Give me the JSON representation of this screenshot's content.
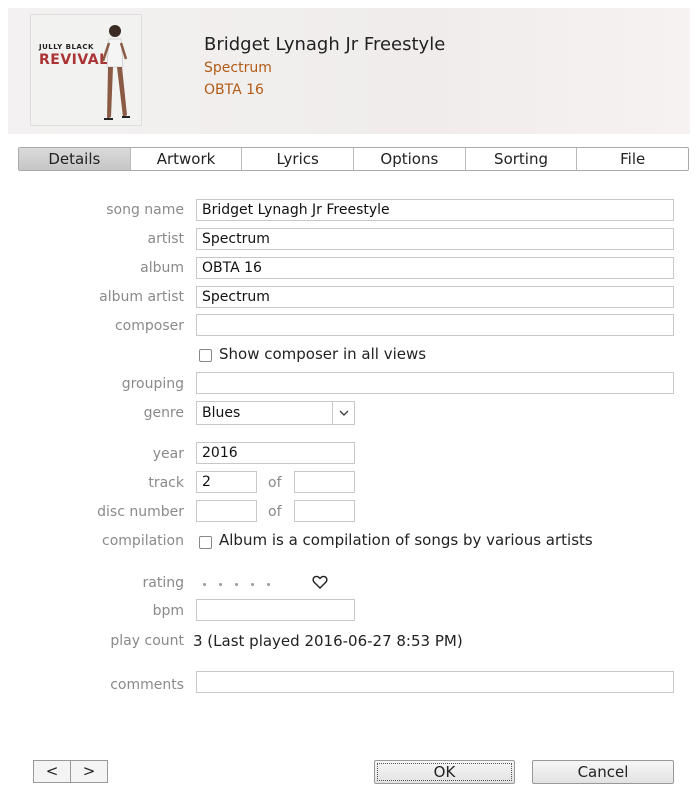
{
  "header": {
    "album_art_text_line1": "JULLY BLACK",
    "album_art_text_line2": "REVIVAL",
    "title": "Bridget Lynagh Jr Freestyle",
    "artist": "Spectrum",
    "album": "OBTA 16"
  },
  "tabs": [
    {
      "label": "Details",
      "active": true
    },
    {
      "label": "Artwork",
      "active": false
    },
    {
      "label": "Lyrics",
      "active": false
    },
    {
      "label": "Options",
      "active": false
    },
    {
      "label": "Sorting",
      "active": false
    },
    {
      "label": "File",
      "active": false
    }
  ],
  "form": {
    "song_name": {
      "label": "song name",
      "value": "Bridget Lynagh Jr Freestyle"
    },
    "artist": {
      "label": "artist",
      "value": "Spectrum"
    },
    "album": {
      "label": "album",
      "value": "OBTA 16"
    },
    "album_artist": {
      "label": "album artist",
      "value": "Spectrum"
    },
    "composer": {
      "label": "composer",
      "value": ""
    },
    "show_composer": {
      "label": "Show composer in all views",
      "checked": false
    },
    "grouping": {
      "label": "grouping",
      "value": ""
    },
    "genre": {
      "label": "genre",
      "value": "Blues"
    },
    "year": {
      "label": "year",
      "value": "2016"
    },
    "track": {
      "label": "track",
      "value": "2",
      "of_label": "of",
      "of_value": ""
    },
    "disc_number": {
      "label": "disc number",
      "value": "",
      "of_label": "of",
      "of_value": ""
    },
    "compilation": {
      "label": "compilation",
      "checkbox_label": "Album is a compilation of songs by various artists",
      "checked": false
    },
    "rating": {
      "label": "rating",
      "stars": 0,
      "loved": false
    },
    "bpm": {
      "label": "bpm",
      "value": ""
    },
    "play_count": {
      "label": "play count",
      "value": "3 (Last played 2016-06-27 8:53 PM)"
    },
    "comments": {
      "label": "comments",
      "value": ""
    }
  },
  "footer": {
    "prev_label": "<",
    "next_label": ">",
    "ok_label": "OK",
    "cancel_label": "Cancel"
  },
  "colors": {
    "accent": "#b25c16",
    "label": "#8a8a8a"
  }
}
